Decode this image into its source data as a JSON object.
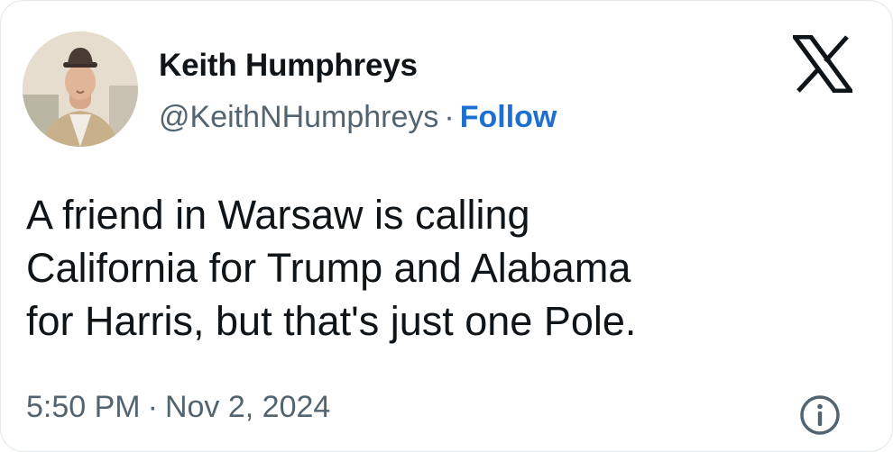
{
  "author": {
    "name": "Keith Humphreys",
    "handle": "@KeithNHumphreys",
    "separator": "·",
    "follow_label": "Follow"
  },
  "tweet": {
    "text_lines": [
      "A friend in Warsaw is calling",
      "California for Trump and Alabama",
      "for Harris, but that's just one Pole."
    ],
    "time": "5:50 PM",
    "separator": "·",
    "date": "Nov 2, 2024"
  },
  "icons": {
    "brand": "x-logo-icon",
    "info": "info-icon",
    "avatar": "avatar-photo"
  },
  "colors": {
    "link": "#1d6fd1",
    "secondary_text": "#536471",
    "primary_text": "#0f1419"
  }
}
